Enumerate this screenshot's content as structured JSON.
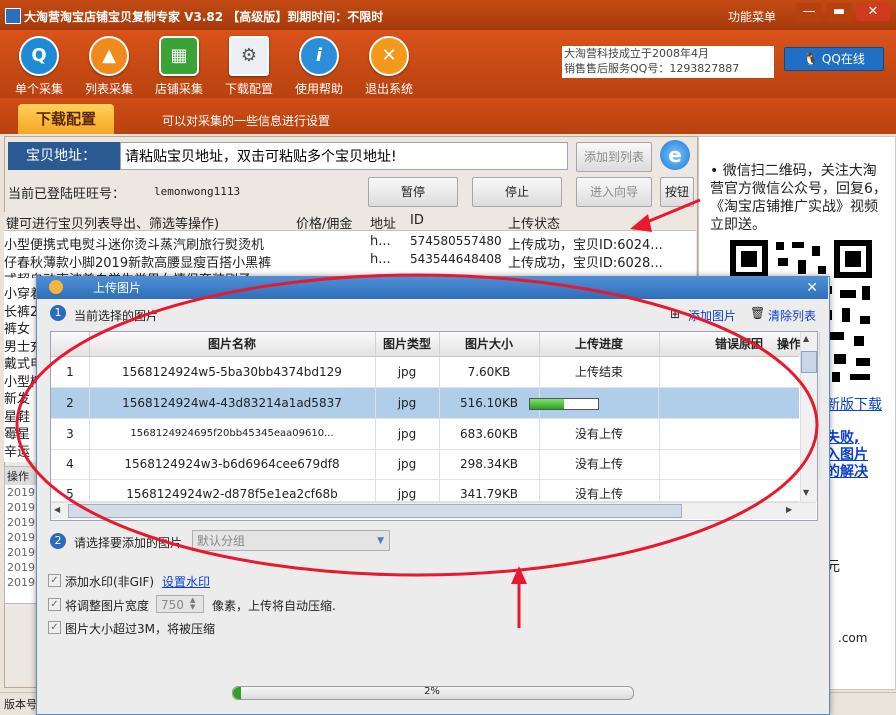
{
  "window": {
    "title": "大淘营淘宝店铺宝贝复制专家 V3.82 【高级版】到期时间：不限时",
    "menu_label": "功能菜单"
  },
  "toolbar": {
    "items": [
      {
        "label": "单个采集",
        "icon": "search-icon",
        "color": "#1d8bd6"
      },
      {
        "label": "列表采集",
        "icon": "list-icon",
        "color": "#f08a1c"
      },
      {
        "label": "店铺采集",
        "icon": "shop-icon",
        "color": "#3aa335"
      },
      {
        "label": "下载配置",
        "icon": "settings-doc-icon",
        "color": "#6d7b8a"
      },
      {
        "label": "使用帮助",
        "icon": "info-icon",
        "color": "#2a8fd8"
      },
      {
        "label": "退出系统",
        "icon": "close-icon",
        "color": "#f39a1d"
      }
    ],
    "company_line1": "大淘营科技成立于2008年4月",
    "company_line2": "销售售后服务QQ号：1293827887",
    "qq_button": "QQ在线"
  },
  "tabs": {
    "active": "下载配置",
    "description": "可以对采集的一些信息进行设置"
  },
  "address": {
    "label": "宝贝地址：",
    "value": "请粘贴宝贝地址，双击可粘贴多个宝贝地址!",
    "add_to_list": "添加到列表",
    "pause": "暂停",
    "stop": "停止",
    "wizard": "进入向导",
    "button": "按钮"
  },
  "login": {
    "label": "当前已登陆旺旺号：",
    "value": "lemonwong1113"
  },
  "bg_table": {
    "headers": [
      "键可进行宝贝列表导出、筛选等操作)",
      "价格/佣金",
      "地址",
      "ID",
      "上传状态"
    ],
    "rows": [
      {
        "name": "小型便携式电熨斗迷你烫斗蒸汽刷旅行熨烫机",
        "addr": "h...",
        "id": "574580557480",
        "status": "上传成功，宝贝ID:6024..."
      },
      {
        "name": "仔春秋薄款小脚2019新款高腰显瘦百搭小黑裤",
        "addr": "h...",
        "id": "543544648408",
        "status": "上传成功，宝贝ID:6028..."
      },
      {
        "name": "式超自动声波美白学生党男女情侣套装刷子",
        "addr": "h...",
        "id": "",
        "status": ""
      }
    ],
    "left_fragments": [
      "小穿着",
      "长裤20",
      "裤女",
      "男士充",
      "戴式电",
      "小型榨",
      "新发",
      "星鞋",
      "霉星",
      "辛运"
    ],
    "ops_label": "操作",
    "log_lines": [
      "2019",
      "2019",
      "2019",
      "2019",
      "2019",
      "2019",
      "2019"
    ]
  },
  "status_bar": {
    "label": "版本号"
  },
  "sidebar": {
    "text": "• 微信扫二维码，关注大淘营官方微信公众号，回复6，《淘宝店铺推广实战》视频立即送。",
    "new_version": "新版下载",
    "warn_lines": [
      "失败,",
      "入图片",
      "的解决"
    ],
    "footer": ".com",
    "frag": "元"
  },
  "dialog": {
    "title": "上传图片",
    "step1": "1",
    "step1_label": "当前选择的图片",
    "add_image": "添加图片",
    "clear_list": "清除列表",
    "headers": [
      "",
      "图片名称",
      "图片类型",
      "图片大小",
      "上传进度",
      "错误原因",
      "操作"
    ],
    "rows": [
      {
        "no": "1",
        "name": "1568124924w5-5ba30bb4374bd129",
        "type": "jpg",
        "size": "7.60KB",
        "progress": "上传结束",
        "pct": null
      },
      {
        "no": "2",
        "name": "1568124924w4-43d83214a1ad5837",
        "type": "jpg",
        "size": "516.10KB",
        "progress": "50%",
        "pct": 0.5
      },
      {
        "no": "3",
        "name": "1568124924695f20bb45345eaa09610...",
        "type": "jpg",
        "size": "683.60KB",
        "progress": "没有上传",
        "pct": null
      },
      {
        "no": "4",
        "name": "1568124924w3-b6d6964cee679df8",
        "type": "jpg",
        "size": "298.34KB",
        "progress": "没有上传",
        "pct": null
      },
      {
        "no": "5",
        "name": "1568124924w2-d878f5e1ea2cf68b",
        "type": "jpg",
        "size": "341.79KB",
        "progress": "没有上传",
        "pct": null
      }
    ],
    "step2": "2",
    "step2_label": "请选择要添加的图片",
    "group_value": "默认分组",
    "watermark_label": "添加水印(非GIF)",
    "watermark_link": "设置水印",
    "resize_label": "将调整图片宽度",
    "resize_value": "750",
    "resize_suffix": "像素，上传将自动压缩.",
    "compress_label": "图片大小超过3M，将被压缩",
    "overall_progress_text": "2%",
    "overall_progress": 0.02
  },
  "colors": {
    "toolbar": "#c44b12",
    "dialog_title": "#3a7bc8",
    "selected_row": "#b0cde9",
    "annotation": "#e8182f"
  }
}
